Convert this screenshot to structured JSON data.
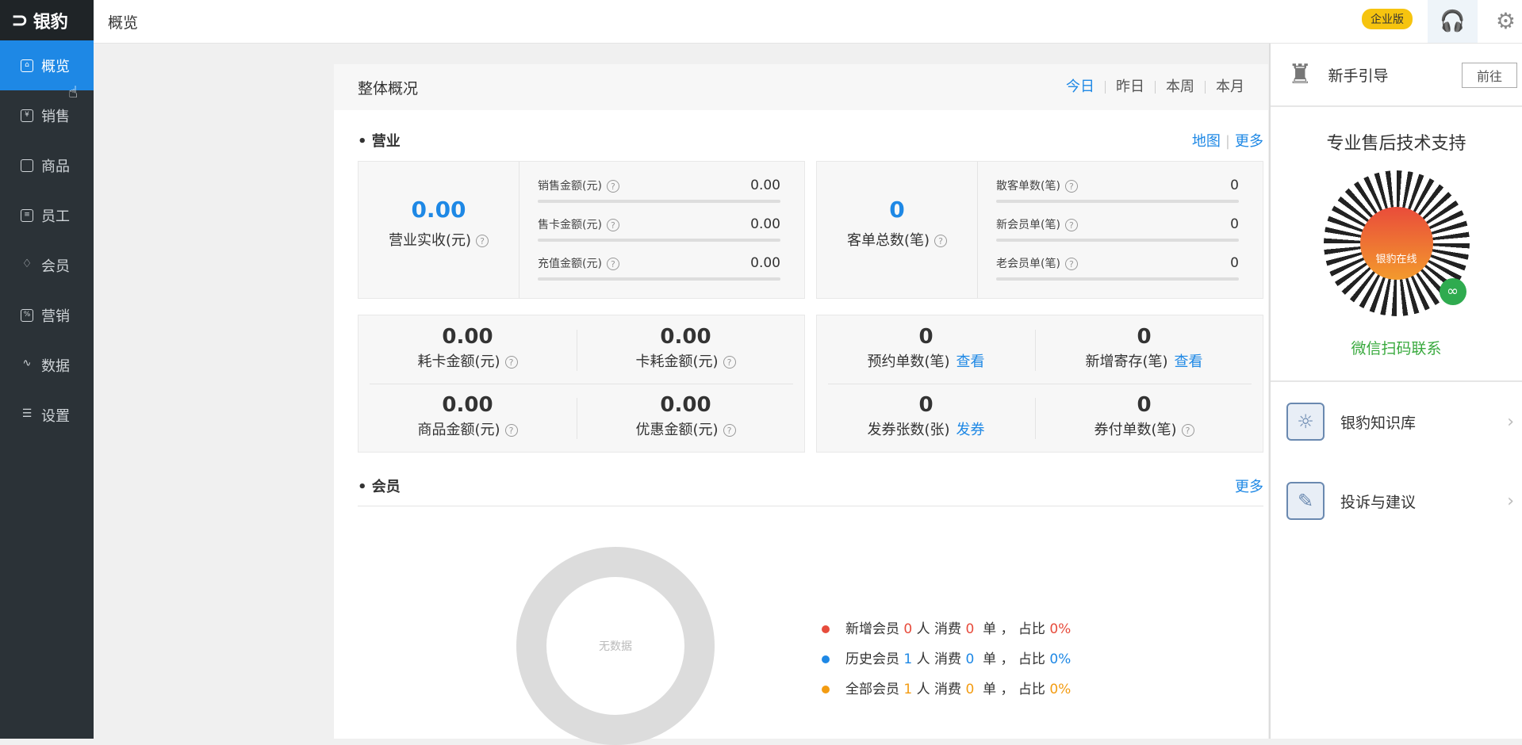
{
  "brand": {
    "logo_text": "银豹"
  },
  "topbar": {
    "title": "概览",
    "edition_badge": "企业版"
  },
  "sidebar": {
    "items": [
      {
        "label": "概览",
        "icon": "home-icon"
      },
      {
        "label": "销售",
        "icon": "money-icon"
      },
      {
        "label": "商品",
        "icon": "box-icon"
      },
      {
        "label": "员工",
        "icon": "id-card-icon"
      },
      {
        "label": "会员",
        "icon": "diamond-icon"
      },
      {
        "label": "营销",
        "icon": "tag-icon"
      },
      {
        "label": "数据",
        "icon": "chart-icon"
      },
      {
        "label": "设置",
        "icon": "sliders-icon"
      }
    ]
  },
  "overview": {
    "title": "整体概况",
    "ranges": [
      "今日",
      "昨日",
      "本周",
      "本月"
    ],
    "business": {
      "title": "营业",
      "links": {
        "map": "地图",
        "more": "更多"
      },
      "revenue": {
        "value": "0.00",
        "label": "营业实收(元)"
      },
      "rows1": [
        {
          "label": "销售金额(元)",
          "value": "0.00"
        },
        {
          "label": "售卡金额(元)",
          "value": "0.00"
        },
        {
          "label": "充值金额(元)",
          "value": "0.00"
        }
      ],
      "orders": {
        "value": "0",
        "label": "客单总数(笔)"
      },
      "rows2": [
        {
          "label": "散客单数(笔)",
          "value": "0"
        },
        {
          "label": "新会员单(笔)",
          "value": "0"
        },
        {
          "label": "老会员单(笔)",
          "value": "0"
        }
      ],
      "grid1": [
        {
          "value": "0.00",
          "label": "耗卡金额(元)"
        },
        {
          "value": "0.00",
          "label": "卡耗金额(元)"
        },
        {
          "value": "0.00",
          "label": "商品金额(元)"
        },
        {
          "value": "0.00",
          "label": "优惠金额(元)"
        }
      ],
      "grid2": [
        {
          "value": "0",
          "label": "预约单数(笔)",
          "link": "查看"
        },
        {
          "value": "0",
          "label": "新增寄存(笔)",
          "link": "查看"
        },
        {
          "value": "0",
          "label": "发券张数(张)",
          "link": "发券"
        },
        {
          "value": "0",
          "label": "券付单数(笔)"
        }
      ]
    },
    "members": {
      "title": "会员",
      "more": "更多",
      "donut_empty": "无数据",
      "legend": [
        {
          "name": "新增会员",
          "count": "0",
          "unit1": "人 消费",
          "orders": "0",
          "unit2": "单 ， 占比",
          "pct": "0%",
          "color": "#e74c3c"
        },
        {
          "name": "历史会员",
          "count": "1",
          "unit1": "人 消费",
          "orders": "0",
          "unit2": "单 ， 占比",
          "pct": "0%",
          "color": "#1e88e5"
        },
        {
          "name": "全部会员",
          "count": "1",
          "unit1": "人 消费",
          "orders": "0",
          "unit2": "单 ， 占比",
          "pct": "0%",
          "color": "#f39c12"
        }
      ]
    }
  },
  "right_panel": {
    "guide_label": "新手引导",
    "goto_button": "前往",
    "support_title": "专业售后技术支持",
    "qr_text": "银豹在线",
    "wechat_text": "微信扫码联系",
    "items": [
      {
        "label": "银豹知识库",
        "icon": "knowledge-book-icon"
      },
      {
        "label": "投诉与建议",
        "icon": "feedback-pen-icon"
      }
    ]
  }
}
